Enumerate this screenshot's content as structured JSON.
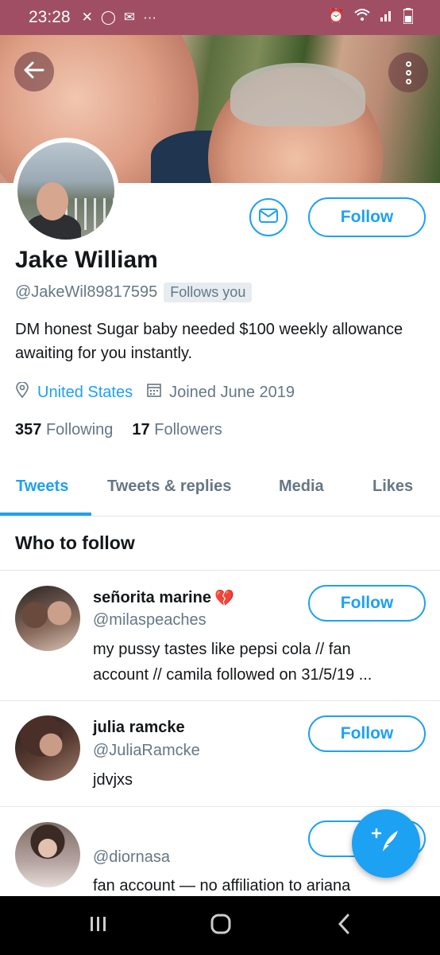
{
  "status_bar": {
    "time": "23:28",
    "notif_icons": [
      "missed-call-icon",
      "whatsapp-icon",
      "gmail-icon",
      "more-dots-icon"
    ],
    "system_icons": [
      "alarm-icon",
      "wifi-icon",
      "signal-icon",
      "battery-icon"
    ]
  },
  "profile": {
    "name": "Jake William",
    "handle": "@JakeWil89817595",
    "follows_you": "Follows you",
    "bio": "DM honest Sugar baby needed $100 weekly allowance awaiting for you instantly.",
    "location": "United States",
    "joined": "Joined June 2019",
    "following_count": "357",
    "following_label": "Following",
    "followers_count": "17",
    "followers_label": "Followers",
    "follow_label": "Follow"
  },
  "tabs": [
    {
      "label": "Tweets",
      "active": true
    },
    {
      "label": "Tweets & replies",
      "active": false
    },
    {
      "label": "Media",
      "active": false
    },
    {
      "label": "Likes",
      "active": false
    }
  ],
  "who_to_follow": {
    "title": "Who to follow",
    "items": [
      {
        "name": "señorita marine",
        "handle": "@milaspeaches",
        "bio_line1": "my pussy tastes like pepsi cola // fan",
        "bio_line2": "account // camila followed on 31/5/19 ...",
        "follow_label": "Follow"
      },
      {
        "name": "julia ramcke",
        "handle": "@JuliaRamcke",
        "bio_line1": "jdvjxs",
        "follow_label": "Follow"
      },
      {
        "name": "",
        "handle": "@diornasa",
        "bio_line1": "fan account — no affiliation to ariana",
        "follow_label": "Fo"
      }
    ]
  },
  "colors": {
    "accent": "#1da1f2",
    "status_bar": "#a04e63",
    "text_secondary": "#657786"
  }
}
